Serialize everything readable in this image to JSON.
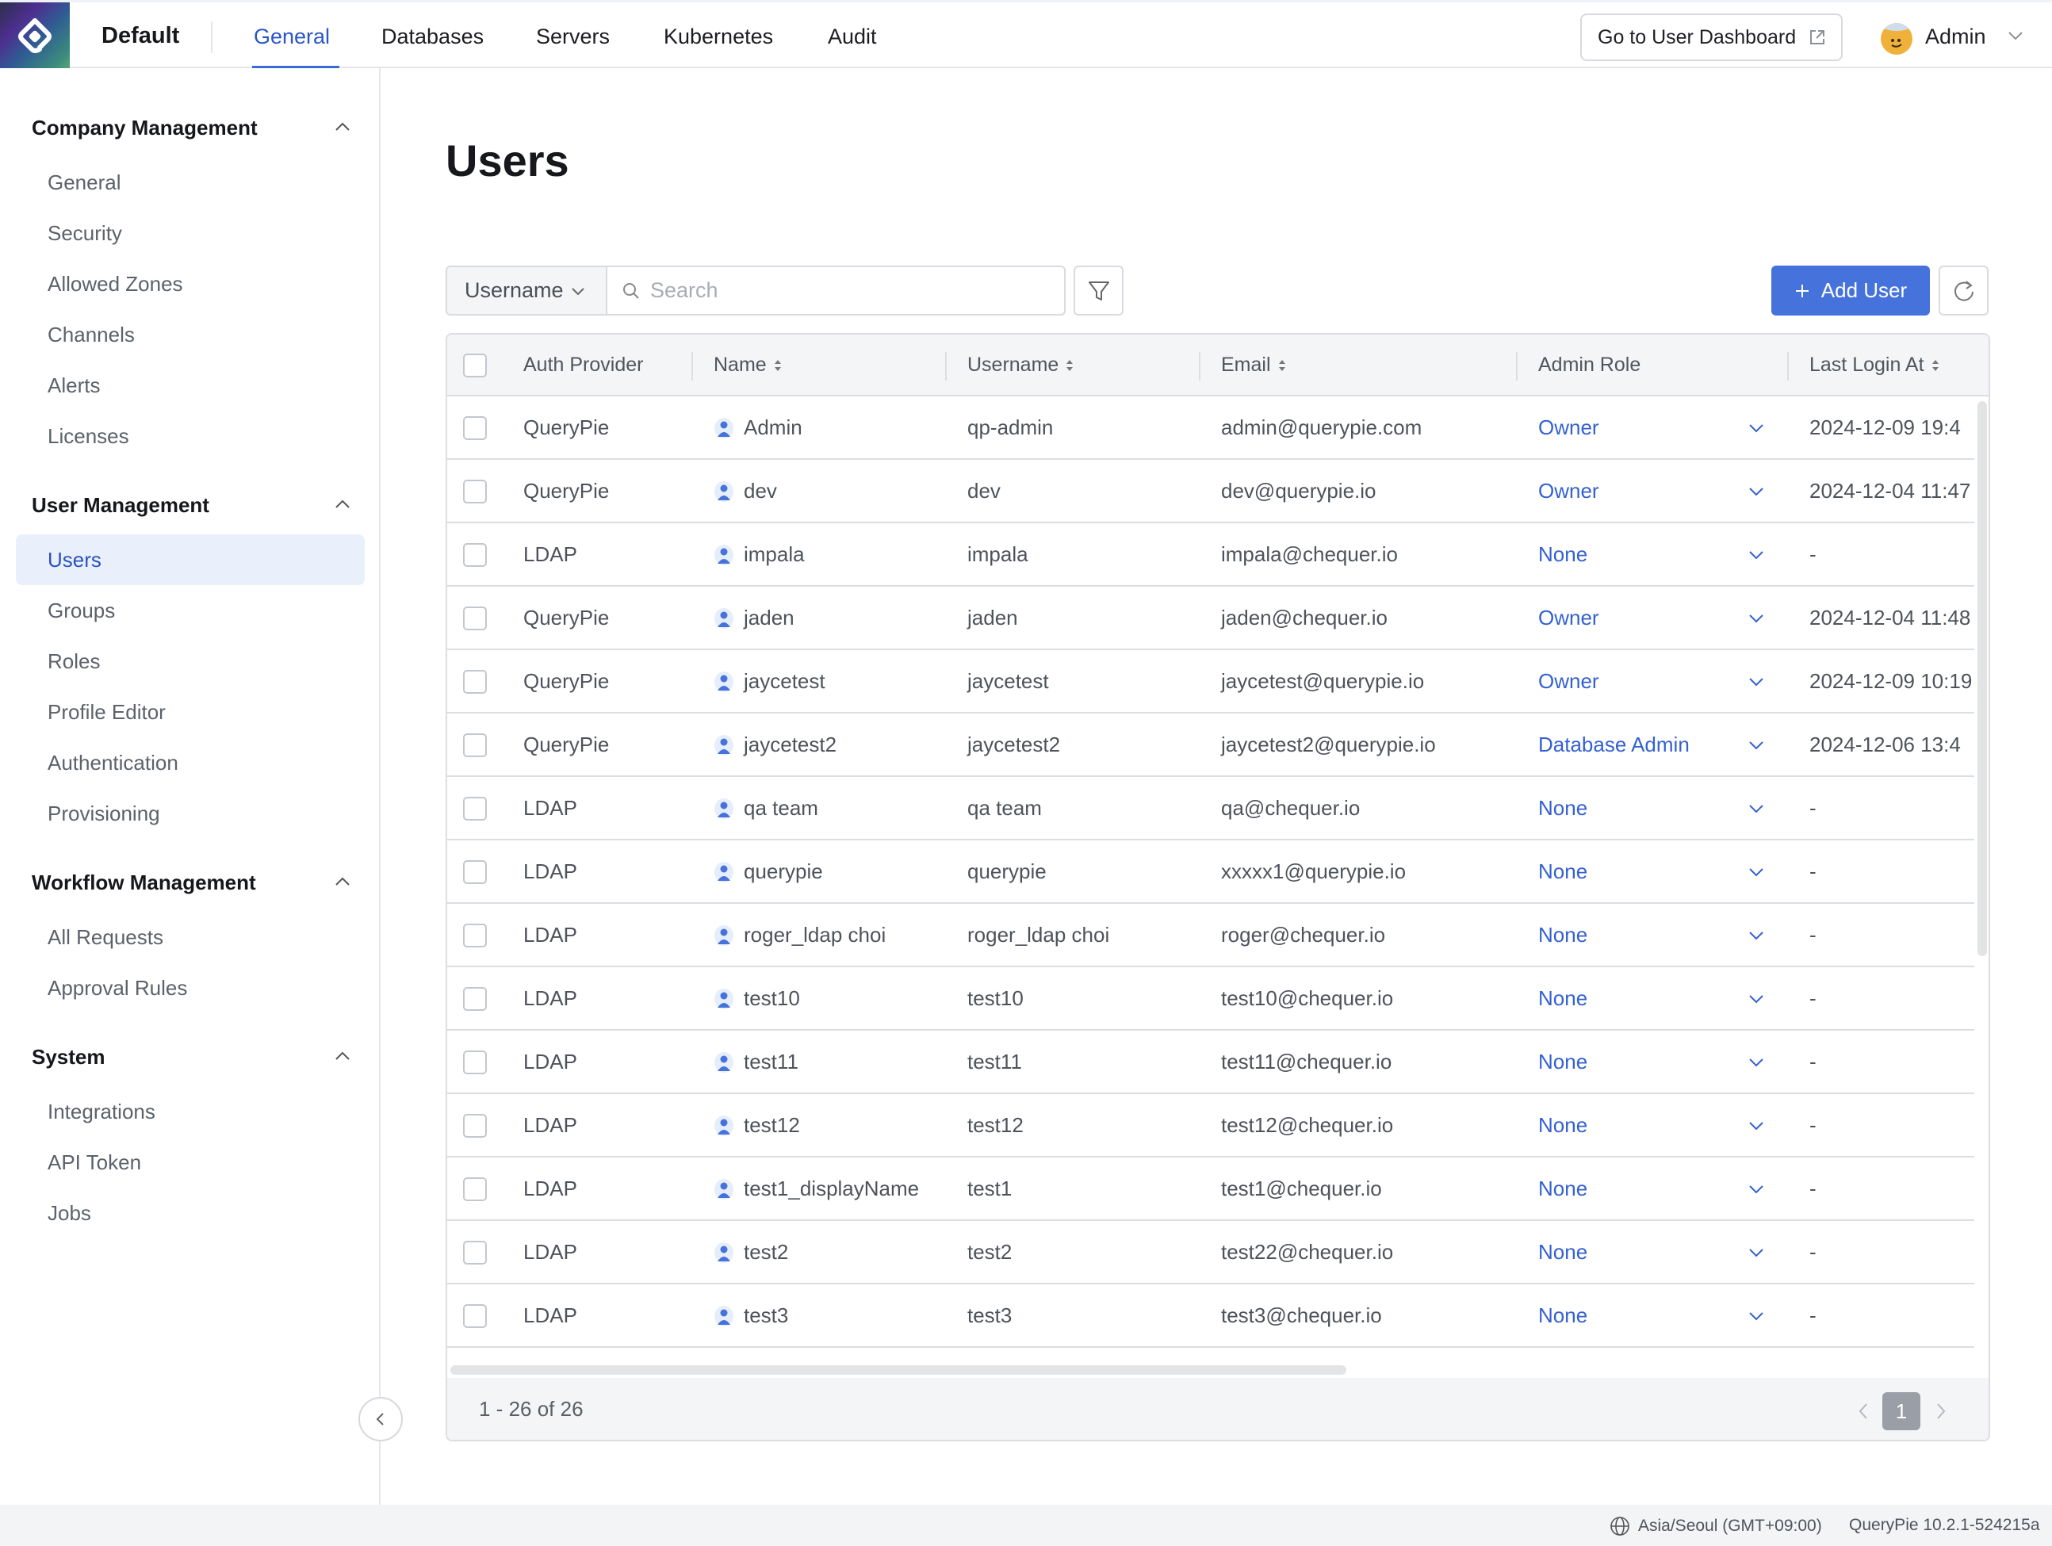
{
  "header": {
    "workspace": "Default",
    "tabs": [
      {
        "label": "General",
        "active": true
      },
      {
        "label": "Databases",
        "active": false
      },
      {
        "label": "Servers",
        "active": false
      },
      {
        "label": "Kubernetes",
        "active": false
      },
      {
        "label": "Audit",
        "active": false
      }
    ],
    "dashboard_button": "Go to User Dashboard",
    "user_name": "Admin"
  },
  "sidebar": {
    "sections": [
      {
        "title": "Company Management",
        "items": [
          "General",
          "Security",
          "Allowed Zones",
          "Channels",
          "Alerts",
          "Licenses"
        ]
      },
      {
        "title": "User Management",
        "items": [
          "Users",
          "Groups",
          "Roles",
          "Profile Editor",
          "Authentication",
          "Provisioning"
        ]
      },
      {
        "title": "Workflow Management",
        "items": [
          "All Requests",
          "Approval Rules"
        ]
      },
      {
        "title": "System",
        "items": [
          "Integrations",
          "API Token",
          "Jobs"
        ]
      }
    ],
    "active_item": "Users"
  },
  "main": {
    "title": "Users",
    "search_field": "Username",
    "search_placeholder": "Search",
    "search_value": "",
    "add_button": "Add User"
  },
  "table": {
    "columns": [
      "Auth Provider",
      "Name",
      "Username",
      "Email",
      "Admin Role",
      "Last Login At"
    ],
    "sortable": [
      false,
      true,
      true,
      true,
      false,
      true
    ],
    "rows": [
      {
        "provider": "QueryPie",
        "name": "Admin",
        "username": "qp-admin",
        "email": "admin@querypie.com",
        "role": "Owner",
        "last_login": "2024-12-09 19:4"
      },
      {
        "provider": "QueryPie",
        "name": "dev",
        "username": "dev",
        "email": "dev@querypie.io",
        "role": "Owner",
        "last_login": "2024-12-04 11:47"
      },
      {
        "provider": "LDAP",
        "name": "impala",
        "username": "impala",
        "email": "impala@chequer.io",
        "role": "None",
        "last_login": "-"
      },
      {
        "provider": "QueryPie",
        "name": "jaden",
        "username": "jaden",
        "email": "jaden@chequer.io",
        "role": "Owner",
        "last_login": "2024-12-04 11:48"
      },
      {
        "provider": "QueryPie",
        "name": "jaycetest",
        "username": "jaycetest",
        "email": "jaycetest@querypie.io",
        "role": "Owner",
        "last_login": "2024-12-09 10:19"
      },
      {
        "provider": "QueryPie",
        "name": "jaycetest2",
        "username": "jaycetest2",
        "email": "jaycetest2@querypie.io",
        "role": "Database Admin",
        "last_login": "2024-12-06 13:4"
      },
      {
        "provider": "LDAP",
        "name": "qa team",
        "username": "qa team",
        "email": "qa@chequer.io",
        "role": "None",
        "last_login": "-"
      },
      {
        "provider": "LDAP",
        "name": "querypie",
        "username": "querypie",
        "email": "xxxxx1@querypie.io",
        "role": "None",
        "last_login": "-"
      },
      {
        "provider": "LDAP",
        "name": "roger_ldap choi",
        "username": "roger_ldap choi",
        "email": "roger@chequer.io",
        "role": "None",
        "last_login": "-"
      },
      {
        "provider": "LDAP",
        "name": "test10",
        "username": "test10",
        "email": "test10@chequer.io",
        "role": "None",
        "last_login": "-"
      },
      {
        "provider": "LDAP",
        "name": "test11",
        "username": "test11",
        "email": "test11@chequer.io",
        "role": "None",
        "last_login": "-"
      },
      {
        "provider": "LDAP",
        "name": "test12",
        "username": "test12",
        "email": "test12@chequer.io",
        "role": "None",
        "last_login": "-"
      },
      {
        "provider": "LDAP",
        "name": "test1_displayName",
        "username": "test1",
        "email": "test1@chequer.io",
        "role": "None",
        "last_login": "-"
      },
      {
        "provider": "LDAP",
        "name": "test2",
        "username": "test2",
        "email": "test22@chequer.io",
        "role": "None",
        "last_login": "-"
      },
      {
        "provider": "LDAP",
        "name": "test3",
        "username": "test3",
        "email": "test3@chequer.io",
        "role": "None",
        "last_login": "-"
      }
    ],
    "range_text": "1 - 26 of 26",
    "current_page": "1"
  },
  "status": {
    "timezone": "Asia/Seoul (GMT+09:00)",
    "version": "QueryPie 10.2.1-524215a"
  },
  "colors": {
    "accent": "#4672dc",
    "link": "#3461d1",
    "active_bg": "#eaf0fb"
  }
}
